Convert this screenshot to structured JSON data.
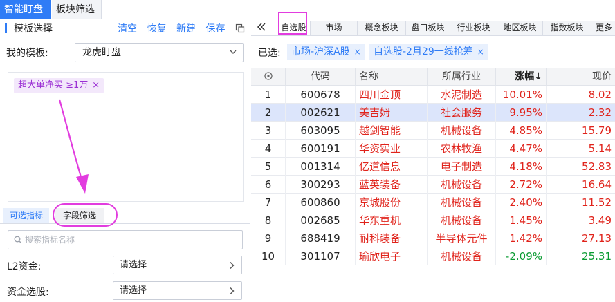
{
  "top_tabs": {
    "active": "智能盯盘",
    "inactive": "板块筛选"
  },
  "template": {
    "title": "模板选择",
    "actions": [
      "清空",
      "恢复",
      "新建",
      "保存"
    ],
    "my_template_label": "我的模板:",
    "my_template_value": "龙虎盯盘",
    "condition_tag": "超大单净买 ≥1万",
    "condition_tag_close": "×"
  },
  "sub_tabs": {
    "indicators": "可选指标",
    "field_filter": "字段筛选"
  },
  "search": {
    "placeholder": "搜索指标名称"
  },
  "fields": [
    {
      "label": "L2资金:",
      "value": "请选择"
    },
    {
      "label": "资金选股:",
      "value": "请选择"
    }
  ],
  "right_tabs": [
    "自选股",
    "市场",
    "概念板块",
    "盘口板块",
    "行业板块",
    "地区板块",
    "指数板块",
    "更多"
  ],
  "selected": {
    "label": "已选:",
    "chips": [
      "市场-沪深A股",
      "自选股-2月29一线抢筹"
    ],
    "chip_close": "×"
  },
  "table": {
    "headers": {
      "code": "代码",
      "name": "名称",
      "industry": "所属行业",
      "change": "涨幅↓",
      "price": "现价"
    },
    "rows": [
      {
        "idx": "1",
        "code": "600678",
        "name": "四川金顶",
        "industry": "水泥制造",
        "change": "10.01%",
        "price": "8.02"
      },
      {
        "idx": "2",
        "code": "002621",
        "name": "美吉姆",
        "industry": "社会服务",
        "change": "9.95%",
        "price": "2.32"
      },
      {
        "idx": "3",
        "code": "603095",
        "name": "越剑智能",
        "industry": "机械设备",
        "change": "4.85%",
        "price": "15.79"
      },
      {
        "idx": "4",
        "code": "600191",
        "name": "华资实业",
        "industry": "农林牧渔",
        "change": "4.47%",
        "price": "5.14"
      },
      {
        "idx": "5",
        "code": "001314",
        "name": "亿道信息",
        "industry": "电子制造",
        "change": "4.18%",
        "price": "52.83"
      },
      {
        "idx": "6",
        "code": "300293",
        "name": "蓝英装备",
        "industry": "机械设备",
        "change": "2.72%",
        "price": "16.64"
      },
      {
        "idx": "7",
        "code": "600860",
        "name": "京城股份",
        "industry": "机械设备",
        "change": "2.40%",
        "price": "11.52"
      },
      {
        "idx": "8",
        "code": "002685",
        "name": "华东重机",
        "industry": "机械设备",
        "change": "1.45%",
        "price": "3.49"
      },
      {
        "idx": "9",
        "code": "688419",
        "name": "耐科装备",
        "industry": "半导体元件",
        "change": "1.42%",
        "price": "27.13"
      },
      {
        "idx": "10",
        "code": "301107",
        "name": "瑜欣电子",
        "industry": "机械设备",
        "change": "-2.09%",
        "price": "25.31"
      }
    ]
  },
  "colors": {
    "accent": "#2f7cf6",
    "up": "#e0231b",
    "down": "#0a9b32",
    "highlight": "#e23ddf",
    "tag": "#9b2fd4"
  }
}
